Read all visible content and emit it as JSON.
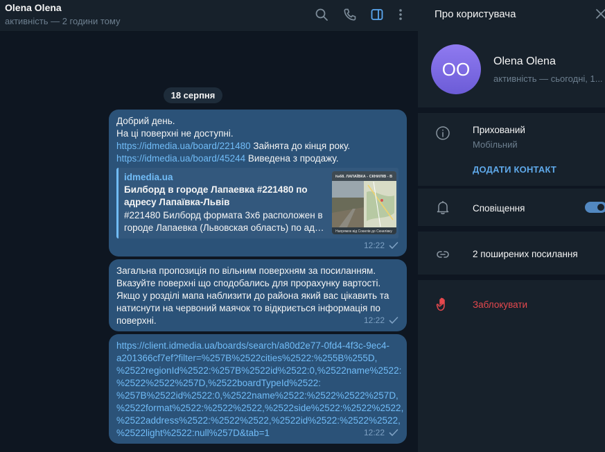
{
  "chat": {
    "title": "Olena Olena",
    "status": "активність — 2 години тому",
    "icons": [
      "search-icon",
      "phone-icon",
      "sidebar-toggle-icon",
      "more-vertical-icon"
    ],
    "date": "18 серпня",
    "messages": [
      {
        "lines": [
          {
            "text": "Добрий день."
          },
          {
            "text": "На ці поверхні не доступні."
          },
          {
            "link": "https://idmedia.ua/board/221480",
            "text": " Зайнята до кінця року."
          },
          {
            "link": "https://idmedia.ua/board/45244",
            "text": " Виведена з продажу."
          }
        ],
        "preview": {
          "site": "idmedia.ua",
          "title": "Билборд в городе Лапаевка #221480 по адресу Лапаївка-Львів",
          "desc_1": "#221480 Билборд формата 3х6 расположен в",
          "desc_2": "городе Лапаевка (Львовская область) по адр...",
          "thumb_caption_top": "№68. ЛАПАЇВКА - СКНИЛІВ - В",
          "thumb_caption_bottom": "Напрямок від Сокилів до Скнилівку"
        },
        "time": "12:22"
      },
      {
        "lines": [
          "Загальна пропозиція по вільним поверхням за посиланням.",
          "Вказуйте поверхні що сподобались для прорахунку вартості.",
          "Якщо у розділі мапа наблизити до района який вас цікавить та",
          "натиснути на червоний маячок то відкриється інформація по",
          "поверхні."
        ],
        "time": "12:22"
      },
      {
        "url_lines": [
          "https://client.idmedia.ua/boards/search/a80d2e77-0fd4-4f3c-9ec4-",
          "a201366cf7ef?filter=%257B%2522cities%2522:%255B%255D,",
          "%2522regionId%2522:%257B%2522id%2522:0,%2522name%2522:",
          "%2522%2522%257D,%2522boardTypeId%2522:",
          "%257B%2522id%2522:0,%2522name%2522:%2522%2522%257D,",
          "%2522format%2522:%2522%2522,%2522side%2522:%2522%2522,",
          "%2522address%2522:%2522%2522,%2522id%2522:%2522%2522,",
          "%2522light%2522:null%257D&tab=1"
        ],
        "time": "12:22"
      }
    ]
  },
  "sidebar": {
    "title": "Про користувача",
    "avatar_initials": "OO",
    "name": "Olena Olena",
    "status": "активність — сьогодні, 1...",
    "phone_label": "Прихований",
    "phone_sub": "Мобільний",
    "add_contact": "ДОДАТИ КОНТАКТ",
    "notifications": "Сповіщення",
    "notifications_on": true,
    "shared_links": "2 поширених посилання",
    "block": "Заблокувати",
    "colors": {
      "accent": "#5288c1",
      "danger": "#e5484d",
      "avatar": "#7c69e3"
    }
  }
}
